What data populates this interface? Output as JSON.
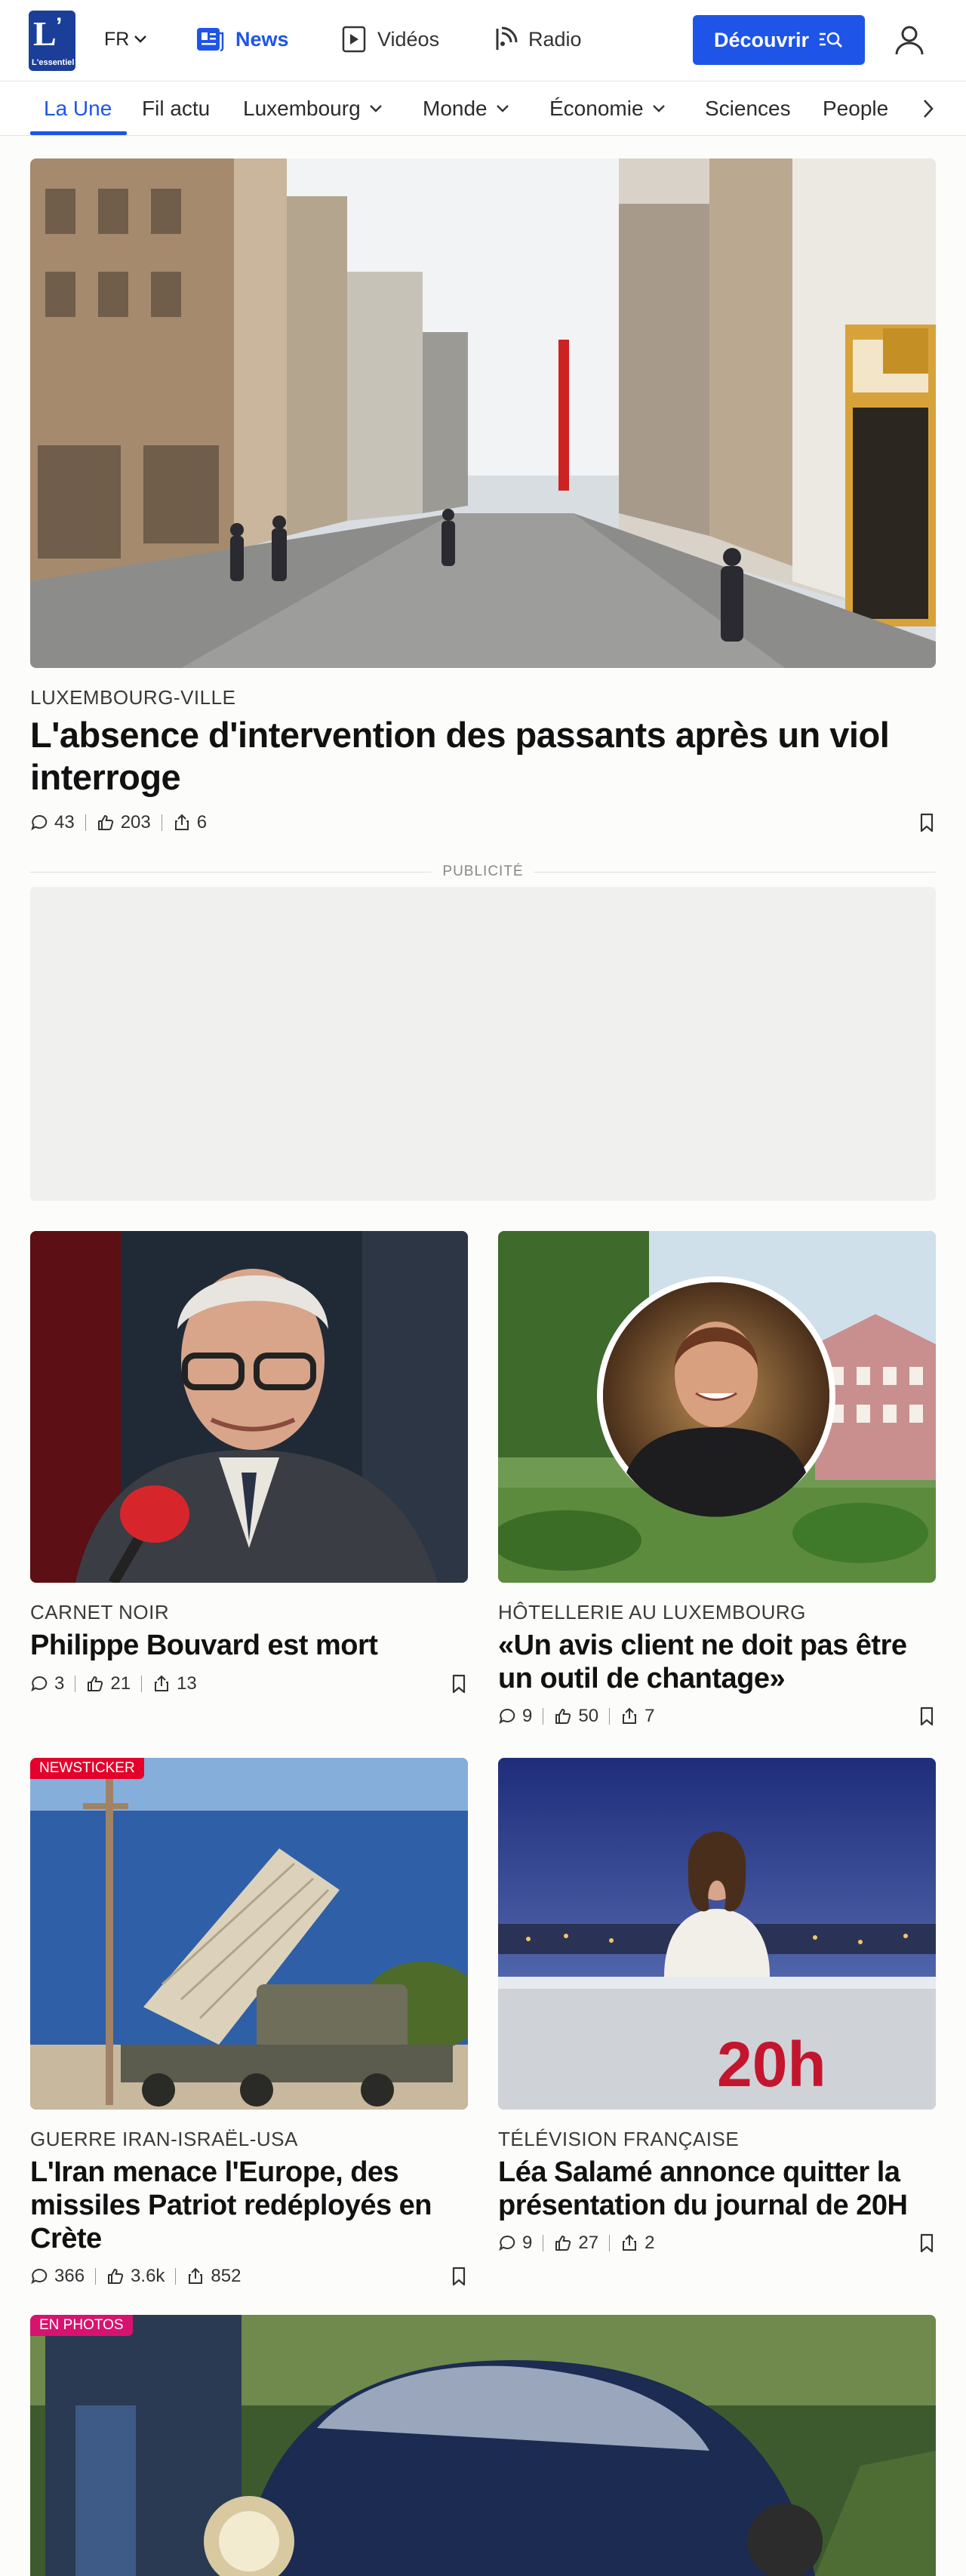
{
  "header": {
    "logo_text": "L'essentiel",
    "logo_letter": "L",
    "language": "FR",
    "nav": [
      {
        "label": "News",
        "icon": "news-icon"
      },
      {
        "label": "Vidéos",
        "icon": "video-play-icon"
      },
      {
        "label": "Radio",
        "icon": "radio-icon"
      }
    ],
    "cta_label": "Découvrir",
    "accent_color": "#1e55e8"
  },
  "categories": [
    {
      "label": "La Une",
      "active": true
    },
    {
      "label": "Fil actu"
    },
    {
      "label": "Luxembourg",
      "dropdown": true
    },
    {
      "label": "Monde",
      "dropdown": true
    },
    {
      "label": "Économie",
      "dropdown": true
    },
    {
      "label": "Sciences"
    },
    {
      "label": "People"
    }
  ],
  "hero": {
    "kicker": "LUXEMBOURG-VILLE",
    "title": "L'absence d'intervention des passants après un viol interroge",
    "comments": "43",
    "likes": "203",
    "shares": "6"
  },
  "ad": {
    "label": "PUBLICITÉ"
  },
  "articles": [
    {
      "kicker": "CARNET NOIR",
      "title": "Philippe Bouvard est mort",
      "comments": "3",
      "likes": "21",
      "shares": "13"
    },
    {
      "kicker": "HÔTELLERIE AU LUXEMBOURG",
      "title": "«Un avis client ne doit pas être un outil de chantage»",
      "comments": "9",
      "likes": "50",
      "shares": "7"
    },
    {
      "badge": "NEWSTICKER",
      "badge_color": "#e4002b",
      "kicker": "GUERRE IRAN-ISRAËL-USA",
      "title": "L'Iran menace l'Europe, des missiles Patriot redéployés en Crète",
      "comments": "366",
      "likes": "3.6k",
      "shares": "852"
    },
    {
      "kicker": "TÉLÉVISION FRANÇAISE",
      "title": "Léa Salamé annonce quitter la présentation du journal de 20H",
      "comments": "9",
      "likes": "27",
      "shares": "2",
      "image_text": "20h"
    },
    {
      "badge": "EN PHOTOS",
      "badge_color": "#d6136f"
    }
  ]
}
